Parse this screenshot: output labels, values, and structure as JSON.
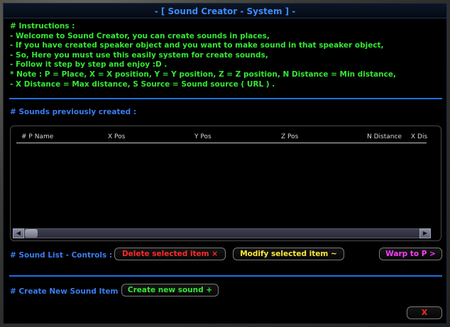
{
  "window": {
    "title": "- [ Sound Creator - System ] -"
  },
  "instructions": {
    "lines": [
      "# Instructions :",
      "- Welcome to Sound Creator, you can create sounds in places,",
      "- If you have created speaker object and you want to make sound in that speaker object,",
      "- So, Here you must use this easily system for create sounds,",
      "- Follow it step by step and enjoy :D .",
      "* Note : P = Place, X = X position, Y = Y position, Z = Z position, N Distance = Min distance,",
      "- X Distance = Max distance, S Source = Sound source ( URL ) ."
    ]
  },
  "sounds_section": {
    "label": "# Sounds previously created :",
    "columns": [
      "# P Name",
      "X Pos",
      "Y Pos",
      "Z Pos",
      "N Distance",
      "X Dis"
    ],
    "rows": []
  },
  "controls": {
    "label": "# Sound List - Controls :",
    "delete_label": "Delete selected item ×",
    "modify_label": "Modify selected item ~",
    "warp_label": "Warp to P >"
  },
  "create": {
    "label": "# Create New Sound Item :",
    "button_label": "Create new sound +"
  },
  "close_label": "X",
  "colors": {
    "title": "#3e8cff",
    "instructions": "#34e834",
    "section": "#3a7ef0",
    "delete": "#ff2a2a",
    "modify": "#ffe93a",
    "warp": "#ff3cff",
    "create": "#34e834",
    "close": "#ff2a2a",
    "separator": "#1f6fe0"
  }
}
